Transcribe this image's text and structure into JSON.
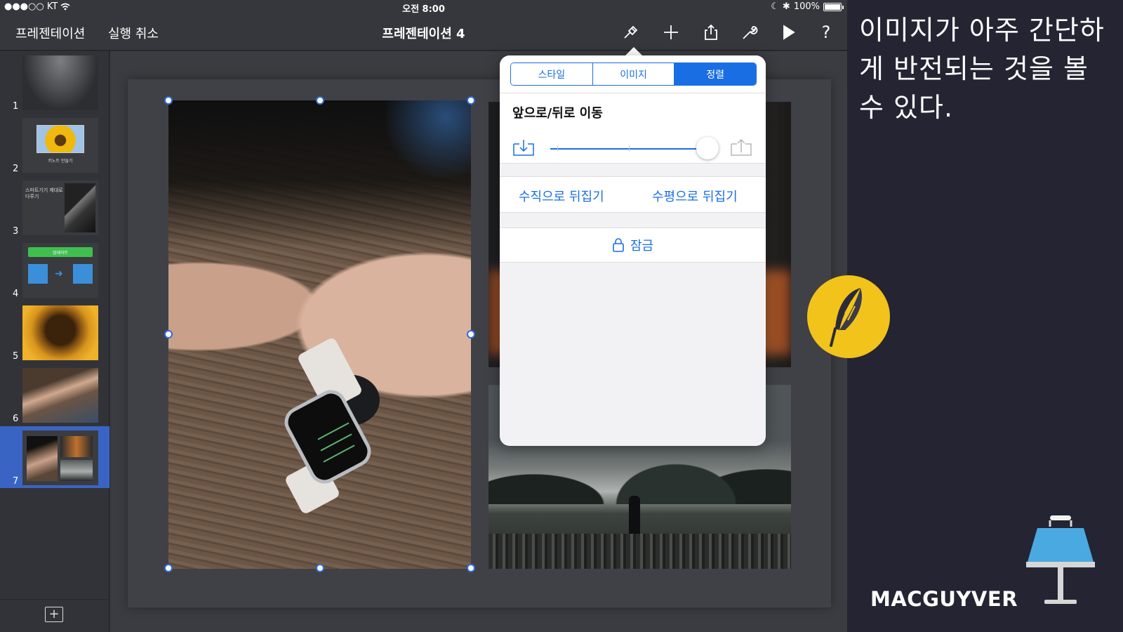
{
  "status_bar": {
    "carrier": "●●●○○ KT",
    "time": "오전 8:00",
    "battery": "100%"
  },
  "toolbar": {
    "presentations_label": "프레젠테이션",
    "undo_label": "실행 취소",
    "document_title": "프레젠테이션 4",
    "icons": [
      "format-brush-icon",
      "plus-icon",
      "share-icon",
      "wrench-icon",
      "play-icon",
      "help-icon"
    ],
    "help_label": "?"
  },
  "sidebar": {
    "slides": [
      {
        "number": "1"
      },
      {
        "number": "2",
        "caption": "키노트 만들기"
      },
      {
        "number": "3",
        "caption": "스마트기기 제대로 다루기"
      },
      {
        "number": "4",
        "caption": "업데이트"
      },
      {
        "number": "5"
      },
      {
        "number": "6"
      },
      {
        "number": "7",
        "selected": true
      }
    ]
  },
  "popover": {
    "tabs": [
      {
        "label": "스타일",
        "active": false
      },
      {
        "label": "이미지",
        "active": false
      },
      {
        "label": "정렬",
        "active": true
      }
    ],
    "arrange_title": "앞으로/뒤로 이동",
    "layer_slider_value": 1.0,
    "flip_vertical_label": "수직으로 뒤집기",
    "flip_horizontal_label": "수평으로 뒤집기",
    "lock_label": "잠금"
  },
  "right_panel": {
    "caption": "이미지가 아주 간단하게 반전되는 것을 볼 수 있다.",
    "brand": "MACGUYVER"
  },
  "colors": {
    "accent": "#1a6ee3",
    "selection_handle": "#2d6bd8",
    "badge_yellow": "#f2c31a",
    "keynote_blue": "#4aa9e0"
  }
}
